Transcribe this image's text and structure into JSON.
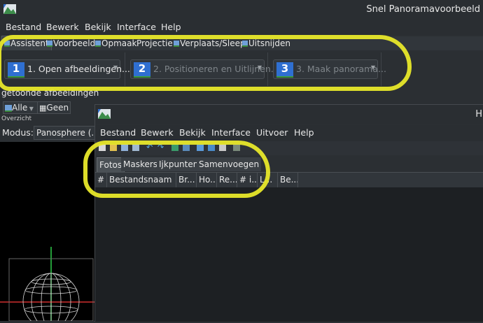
{
  "window": {
    "title": "Snel Panoramavoorbeeld"
  },
  "menu": [
    "Bestand",
    "Bewerk",
    "Bekijk",
    "Interface",
    "Help"
  ],
  "tabs": [
    "Assistent",
    "Voorbeeld",
    "Opmaak",
    "Projectie",
    "Verplaats/Sleep",
    "Uitsnijden"
  ],
  "steps": [
    {
      "num": "1",
      "label": "1. Open afbeeldingen..."
    },
    {
      "num": "2",
      "label": "2. Positioneren en Uitlijnen..."
    },
    {
      "num": "3",
      "label": "3. Maak panorama..."
    }
  ],
  "side": {
    "shown_label": "getoonde afbeeldingen",
    "all_button": "Alle",
    "none_button": "Geen",
    "overview_label": "Overzicht",
    "mode_label": "Modus:",
    "mode_value": "Panosphere (..."
  },
  "win2": {
    "title": "H",
    "menu": [
      "Bestand",
      "Bewerk",
      "Bekijk",
      "Interface",
      "Uitvoer",
      "Help"
    ],
    "tabs": [
      "Fotos",
      "Maskers",
      "Ijkpunten",
      "Samenvoegen"
    ],
    "columns": [
      "#",
      "Bestandsnaam",
      "Br...",
      "Ho...",
      "Re...",
      "# i...",
      "L...",
      "Be..."
    ]
  },
  "colors": {
    "highlight": "#e8e82a",
    "step_badge": "#2f6fd1"
  }
}
